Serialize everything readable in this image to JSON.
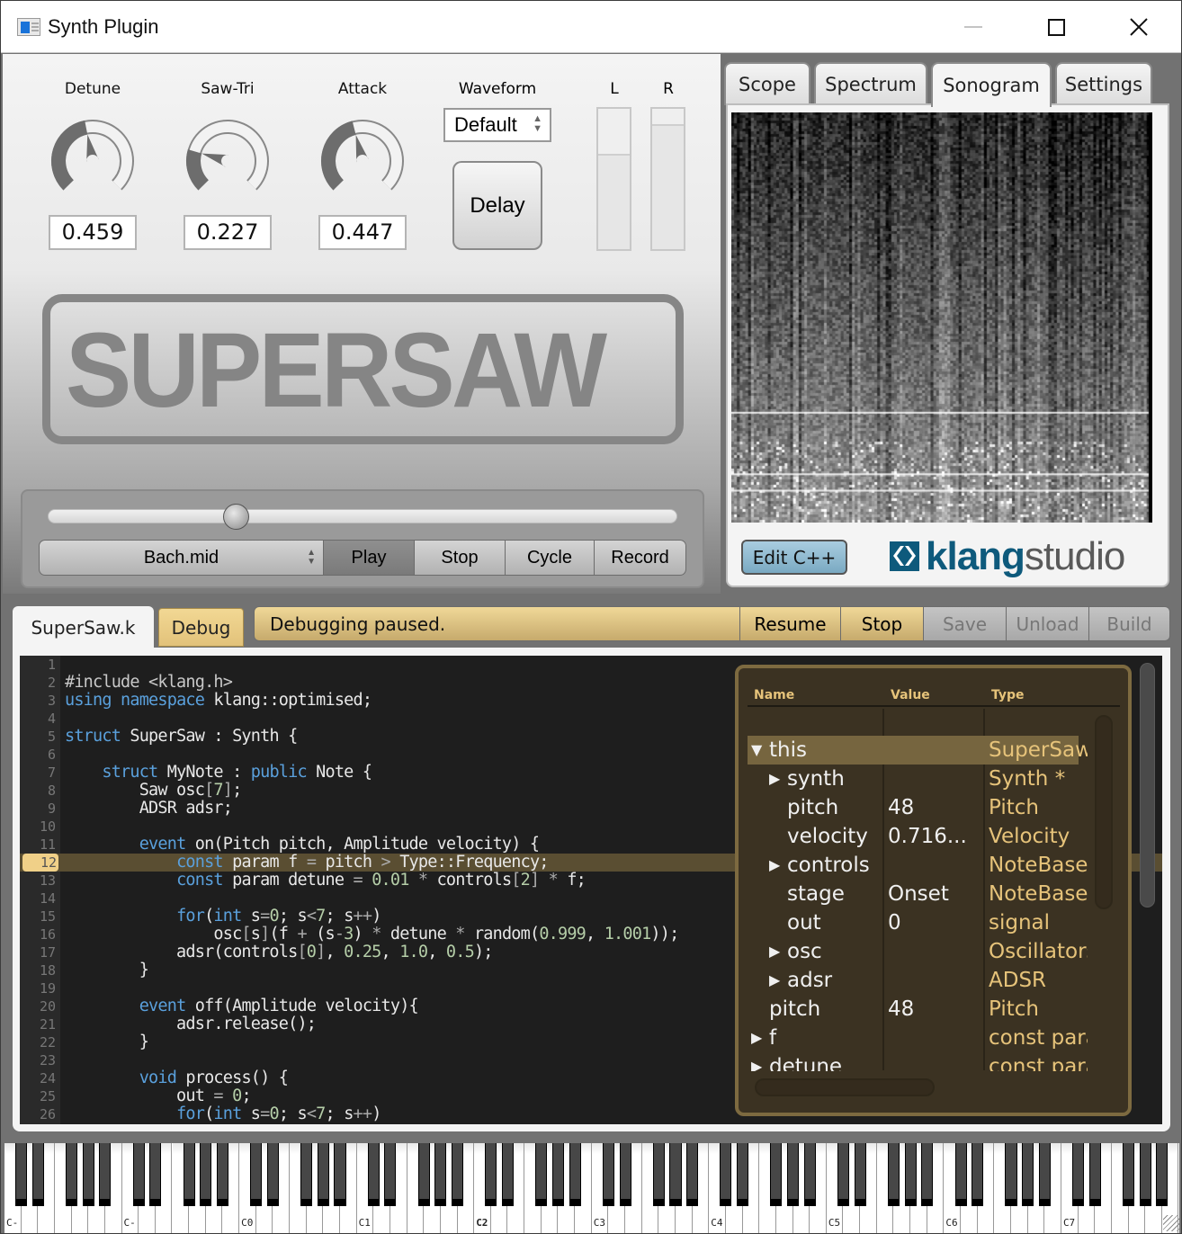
{
  "window": {
    "title": "Synth Plugin",
    "icons": {
      "app": "window-app-icon",
      "minimize": "minimize-icon",
      "maximize": "maximize-icon",
      "close": "close-icon"
    }
  },
  "knobs": [
    {
      "label": "Detune",
      "value": "0.459",
      "level": 0.459
    },
    {
      "label": "Saw-Tri",
      "value": "0.227",
      "level": 0.227
    },
    {
      "label": "Attack",
      "value": "0.447",
      "level": 0.447
    }
  ],
  "waveform": {
    "label": "Waveform",
    "selected": "Default"
  },
  "delay_button": "Delay",
  "meters": [
    {
      "label": "L",
      "level": 0.68
    },
    {
      "label": "R",
      "level": 0.89
    }
  ],
  "logo": {
    "text": "SUPERSAW"
  },
  "transport": {
    "position": 0.29,
    "file": "Bach.mid",
    "play": "Play",
    "stop": "Stop",
    "cycle": "Cycle",
    "record": "Record"
  },
  "analyzer": {
    "tabs": [
      "Scope",
      "Spectrum",
      "Sonogram",
      "Settings"
    ],
    "active_tab": "Sonogram",
    "edit_button": "Edit C++",
    "brand_bold": "klang",
    "brand_light": "studio"
  },
  "debug": {
    "file_tab": "SuperSaw.k",
    "debug_tab": "Debug",
    "status": "Debugging paused.",
    "resume": "Resume",
    "stop": "Stop",
    "save": "Save",
    "unload": "Unload",
    "build": "Build"
  },
  "editor": {
    "current_line": 12,
    "lines": [
      "",
      "#include <klang.h>",
      "using namespace klang::optimised;",
      "",
      "struct SuperSaw : Synth {",
      "",
      "    struct MyNote : public Note {",
      "        Saw osc[7];",
      "        ADSR adsr;",
      "",
      "        event on(Pitch pitch, Amplitude velocity) {",
      "            const param f = pitch > Type::Frequency;",
      "            const param detune = 0.01 * controls[2] * f;",
      "",
      "            for(int s=0; s<7; s++)",
      "                osc[s](f + (s-3) * detune * random(0.999, 1.001));",
      "            adsr(controls[0], 0.25, 1.0, 0.5);",
      "        }",
      "",
      "        event off(Amplitude velocity){",
      "            adsr.release();",
      "        }",
      "",
      "        void process() {",
      "            out = 0;",
      "            for(int s=0; s<7; s++)"
    ]
  },
  "watch": {
    "headers": {
      "name": "Name",
      "value": "Value",
      "type": "Type"
    },
    "rows": [
      {
        "name": "this",
        "value": "",
        "type": "SuperSaw",
        "indent": 0,
        "expander": "expanded",
        "selected": true
      },
      {
        "name": "synth",
        "value": "",
        "type": "Synth *",
        "indent": 1,
        "expander": "collapsed"
      },
      {
        "name": "pitch",
        "value": "48",
        "type": "Pitch",
        "indent": 1,
        "expander": "none"
      },
      {
        "name": "velocity",
        "value": "0.716...",
        "type": "Velocity",
        "indent": 1,
        "expander": "none"
      },
      {
        "name": "controls",
        "value": "",
        "type": "NoteBase",
        "indent": 1,
        "expander": "collapsed"
      },
      {
        "name": "stage",
        "value": "Onset",
        "type": "NoteBase",
        "indent": 1,
        "expander": "none"
      },
      {
        "name": "out",
        "value": "0",
        "type": "signal",
        "indent": 1,
        "expander": "none"
      },
      {
        "name": "osc",
        "value": "",
        "type": "Oscillators",
        "indent": 1,
        "expander": "collapsed"
      },
      {
        "name": "adsr",
        "value": "",
        "type": "ADSR",
        "indent": 1,
        "expander": "collapsed"
      },
      {
        "name": "pitch",
        "value": "48",
        "type": "Pitch",
        "indent": 0,
        "expander": "none"
      },
      {
        "name": "f",
        "value": "",
        "type": "const param",
        "indent": 0,
        "expander": "collapsed"
      },
      {
        "name": "detune",
        "value": "",
        "type": "const param",
        "indent": 0,
        "expander": "collapsed"
      }
    ]
  },
  "piano": {
    "octave_labels": [
      "C-",
      "C-",
      "C0",
      "C1",
      "C2",
      "C3",
      "C4",
      "C5",
      "C6",
      "C7"
    ],
    "highlighted_label": "C2"
  }
}
